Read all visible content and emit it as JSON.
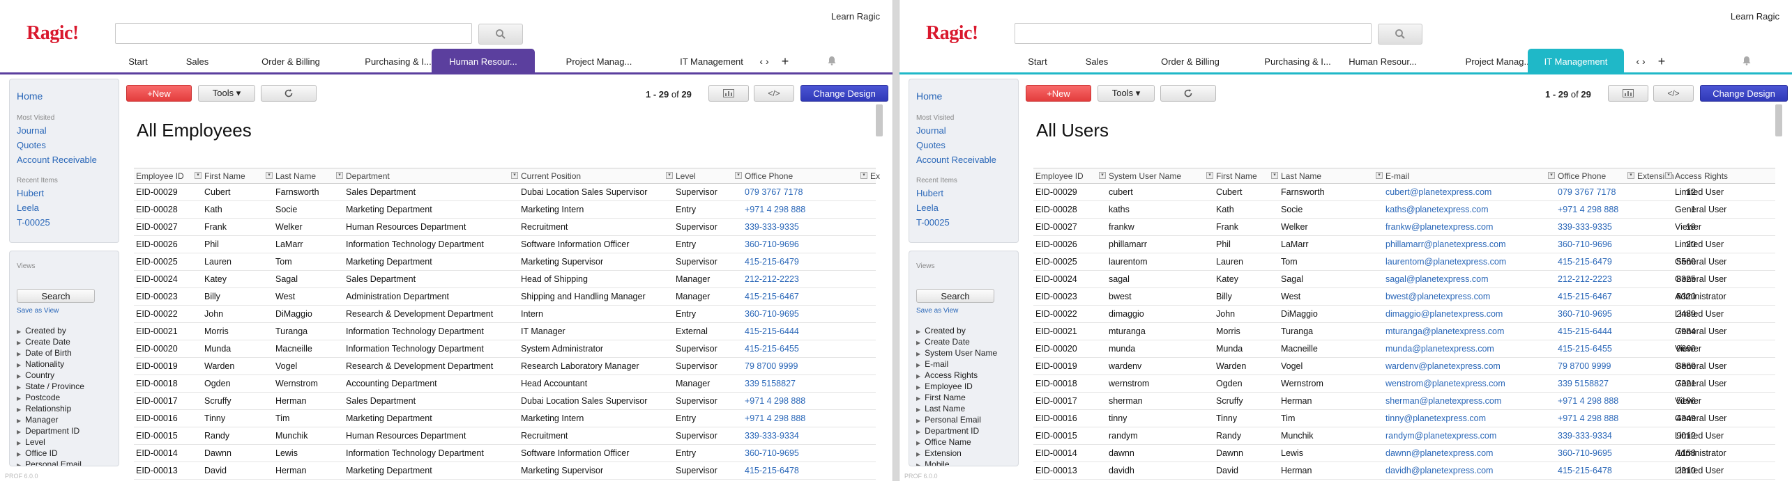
{
  "left": {
    "logo": "Ragic!",
    "learn": "Learn Ragic",
    "accent": "#5b3f9e",
    "tabs": [
      "Start",
      "Sales",
      "Order & Billing",
      "Purchasing & I...",
      "Human Resour...",
      "Project Manag...",
      "IT Management"
    ],
    "active_tab": 4,
    "tab_overflow": "‹ ›",
    "sidebar": {
      "home": "Home",
      "most_visited_label": "Most Visited",
      "most_visited": [
        "Journal",
        "Quotes",
        "Account Receivable"
      ],
      "recent_label": "Recent Items",
      "recent": [
        "Hubert",
        "Leela",
        "T-00025"
      ]
    },
    "views": {
      "label": "Views",
      "search": "Search",
      "save": "Save as View",
      "fields": [
        "Created by",
        "Create Date",
        "Date of Birth",
        "Nationality",
        "Country",
        "State / Province",
        "Postcode",
        "Relationship",
        "Manager",
        "Department ID",
        "Level",
        "Office ID",
        "Personal Email"
      ]
    },
    "toolbar": {
      "new": "+New",
      "tools": "Tools ▾",
      "pager_range": "1 - 29",
      "pager_of": "of",
      "pager_total": "29",
      "design": "Change Design"
    },
    "title": "All Employees",
    "columns": [
      "Employee ID",
      "First Name",
      "Last Name",
      "Department",
      "Current Position",
      "Level",
      "Office Phone",
      "Ex"
    ],
    "rows": [
      [
        "EID-00029",
        "Cubert",
        "Farnsworth",
        "Sales Department",
        "Dubai Location Sales Supervisor",
        "Supervisor",
        "079 3767 7178"
      ],
      [
        "EID-00028",
        "Kath",
        "Socie",
        "Marketing Department",
        "Marketing Intern",
        "Entry",
        "+971 4 298 888"
      ],
      [
        "EID-00027",
        "Frank",
        "Welker",
        "Human Resources Department",
        "Recruitment",
        "Supervisor",
        "339-333-9335"
      ],
      [
        "EID-00026",
        "Phil",
        "LaMarr",
        "Information Technology Department",
        "Software Information Officer",
        "Entry",
        "360-710-9696"
      ],
      [
        "EID-00025",
        "Lauren",
        "Tom",
        "Marketing Department",
        "Marketing Supervisor",
        "Supervisor",
        "415-215-6479"
      ],
      [
        "EID-00024",
        "Katey",
        "Sagal",
        "Sales Department",
        "Head of Shipping",
        "Manager",
        "212-212-2223"
      ],
      [
        "EID-00023",
        "Billy",
        "West",
        "Administration Department",
        "Shipping and Handling Manager",
        "Manager",
        "415-215-6467"
      ],
      [
        "EID-00022",
        "John",
        "DiMaggio",
        "Research & Development Department",
        "Intern",
        "Entry",
        "360-710-9695"
      ],
      [
        "EID-00021",
        "Morris",
        "Turanga",
        "Information Technology Department",
        "IT Manager",
        "External",
        "415-215-6444"
      ],
      [
        "EID-00020",
        "Munda",
        "Macneille",
        "Information Technology Department",
        "System Administrator",
        "Supervisor",
        "415-215-6455"
      ],
      [
        "EID-00019",
        "Warden",
        "Vogel",
        "Research & Development Department",
        "Research Laboratory Manager",
        "Supervisor",
        "79 8700 9999"
      ],
      [
        "EID-00018",
        "Ogden",
        "Wernstrom",
        "Accounting Department",
        "Head Accountant",
        "Manager",
        "339 5158827"
      ],
      [
        "EID-00017",
        "Scruffy",
        "Herman",
        "Sales Department",
        "Dubai Location Sales Supervisor",
        "Supervisor",
        "+971 4 298 888"
      ],
      [
        "EID-00016",
        "Tinny",
        "Tim",
        "Marketing Department",
        "Marketing Intern",
        "Entry",
        "+971 4 298 888"
      ],
      [
        "EID-00015",
        "Randy",
        "Munchik",
        "Human Resources Department",
        "Recruitment",
        "Supervisor",
        "339-333-9334"
      ],
      [
        "EID-00014",
        "Dawnn",
        "Lewis",
        "Information Technology Department",
        "Software Information Officer",
        "Entry",
        "360-710-9695"
      ],
      [
        "EID-00013",
        "David",
        "Herman",
        "Marketing Department",
        "Marketing Supervisor",
        "Supervisor",
        "415-215-6478"
      ]
    ],
    "version": "PROF 6.0.0"
  },
  "right": {
    "logo": "Ragic!",
    "learn": "Learn Ragic",
    "accent": "#1fb8c8",
    "tabs": [
      "Start",
      "Sales",
      "Order & Billing",
      "Purchasing & I...",
      "Human Resour...",
      "Project Manag...",
      "IT Management"
    ],
    "active_tab": 6,
    "tab_overflow": "‹ ›",
    "sidebar": {
      "home": "Home",
      "most_visited_label": "Most Visited",
      "most_visited": [
        "Journal",
        "Quotes",
        "Account Receivable"
      ],
      "recent_label": "Recent Items",
      "recent": [
        "Hubert",
        "Leela",
        "T-00025"
      ]
    },
    "views": {
      "label": "Views",
      "search": "Search",
      "save": "Save as View",
      "fields": [
        "Created by",
        "Create Date",
        "System User Name",
        "E-mail",
        "Access Rights",
        "Employee ID",
        "First Name",
        "Last Name",
        "Personal Email",
        "Department ID",
        "Office Name",
        "Extension",
        "Mobile"
      ]
    },
    "toolbar": {
      "new": "+New",
      "tools": "Tools ▾",
      "pager_range": "1 - 29",
      "pager_of": "of",
      "pager_total": "29",
      "design": "Change Design"
    },
    "title": "All Users",
    "columns": [
      "Employee ID",
      "System User Name",
      "First Name",
      "Last Name",
      "E-mail",
      "Office Phone",
      "Extension",
      "Access Rights"
    ],
    "rows": [
      [
        "EID-00029",
        "cubert",
        "Cubert",
        "Farnsworth",
        "cubert@planetexpress.com",
        "079 3767 7178",
        "12",
        "Limited User"
      ],
      [
        "EID-00028",
        "kaths",
        "Kath",
        "Socie",
        "kaths@planetexpress.com",
        "+971 4 298 888",
        "1",
        "General User"
      ],
      [
        "EID-00027",
        "frankw",
        "Frank",
        "Welker",
        "frankw@planetexpress.com",
        "339-333-9335",
        "19",
        "Viewer"
      ],
      [
        "EID-00026",
        "phillamarr",
        "Phil",
        "LaMarr",
        "phillamarr@planetexpress.com",
        "360-710-9696",
        "20",
        "Limited User"
      ],
      [
        "EID-00025",
        "laurentom",
        "Lauren",
        "Tom",
        "laurentom@planetexpress.com",
        "415-215-6479",
        "5560",
        "General User"
      ],
      [
        "EID-00024",
        "sagal",
        "Katey",
        "Sagal",
        "sagal@planetexpress.com",
        "212-212-2223",
        "8325",
        "General User"
      ],
      [
        "EID-00023",
        "bwest",
        "Billy",
        "West",
        "bwest@planetexpress.com",
        "415-215-6467",
        "8320",
        "Administrator"
      ],
      [
        "EID-00022",
        "dimaggio",
        "John",
        "DiMaggio",
        "dimaggio@planetexpress.com",
        "360-710-9695",
        "2489",
        "Limited User"
      ],
      [
        "EID-00021",
        "mturanga",
        "Morris",
        "Turanga",
        "mturanga@planetexpress.com",
        "415-215-6444",
        "7984",
        "General User"
      ],
      [
        "EID-00020",
        "munda",
        "Munda",
        "Macneille",
        "munda@planetexpress.com",
        "415-215-6455",
        "9660",
        "Viewer"
      ],
      [
        "EID-00019",
        "wardenv",
        "Warden",
        "Vogel",
        "wardenv@planetexpress.com",
        "79 8700 9999",
        "8860",
        "General User"
      ],
      [
        "EID-00018",
        "wernstrom",
        "Ogden",
        "Wernstrom",
        "wenstrom@planetexpress.com",
        "339 5158827",
        "7321",
        "General User"
      ],
      [
        "EID-00017",
        "sherman",
        "Scruffy",
        "Herman",
        "sherman@planetexpress.com",
        "+971 4 298 888",
        "5196",
        "Viewer"
      ],
      [
        "EID-00016",
        "tinny",
        "Tinny",
        "Tim",
        "tinny@planetexpress.com",
        "+971 4 298 888",
        "4349",
        "General User"
      ],
      [
        "EID-00015",
        "randym",
        "Randy",
        "Munchik",
        "randym@planetexpress.com",
        "339-333-9334",
        "9012",
        "Limited User"
      ],
      [
        "EID-00014",
        "dawnn",
        "Dawnn",
        "Lewis",
        "dawnn@planetexpress.com",
        "360-710-9695",
        "1158",
        "Administrator"
      ],
      [
        "EID-00013",
        "davidh",
        "David",
        "Herman",
        "davidh@planetexpress.com",
        "415-215-6478",
        "2310",
        "Limited User"
      ]
    ],
    "version": "PROF 6.0.0"
  }
}
